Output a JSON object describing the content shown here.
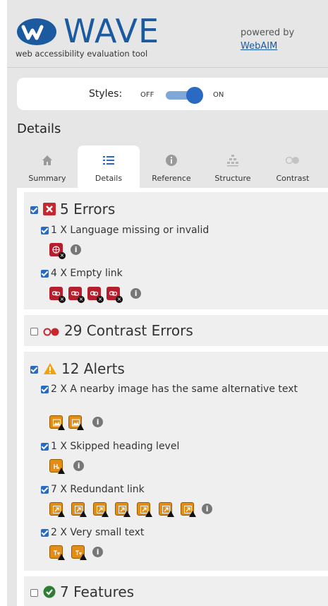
{
  "header": {
    "logo_text": "WAVE",
    "tagline": "web accessibility evaluation tool",
    "powered_by": "powered by",
    "webaim_link": "WebAIM"
  },
  "styles_toggle": {
    "label": "Styles:",
    "off": "OFF",
    "on": "ON",
    "state": "on"
  },
  "section_title": "Details",
  "tabs": [
    {
      "label": "Summary",
      "icon": "home-icon"
    },
    {
      "label": "Details",
      "icon": "list-icon",
      "active": true
    },
    {
      "label": "Reference",
      "icon": "info-icon"
    },
    {
      "label": "Structure",
      "icon": "structure-icon"
    },
    {
      "label": "Contrast",
      "icon": "contrast-icon"
    }
  ],
  "categories": {
    "errors": {
      "label": "5 Errors",
      "checked": true,
      "items": [
        {
          "label": "1 X Language missing or invalid",
          "count": 1,
          "icon": "language-error-icon"
        },
        {
          "label": "4 X Empty link",
          "count": 4,
          "icon": "empty-link-error-icon"
        }
      ]
    },
    "contrast": {
      "label": "29 Contrast Errors",
      "checked": false
    },
    "alerts": {
      "label": "12 Alerts",
      "checked": true,
      "items": [
        {
          "label": "2 X A nearby image has the same alternative text",
          "count": 2,
          "icon": "same-alt-alert-icon"
        },
        {
          "label": "1 X Skipped heading level",
          "count": 1,
          "icon": "skipped-heading-alert-icon"
        },
        {
          "label": "7 X Redundant link",
          "count": 7,
          "icon": "redundant-link-alert-icon"
        },
        {
          "label": "2 X Very small text",
          "count": 2,
          "icon": "small-text-alert-icon"
        }
      ]
    },
    "features": {
      "label": "7 Features",
      "checked": false
    }
  },
  "colors": {
    "accent": "#2b6ac2",
    "error": "#b41e2d",
    "alert": "#e18d17",
    "feature": "#2e7d32"
  }
}
